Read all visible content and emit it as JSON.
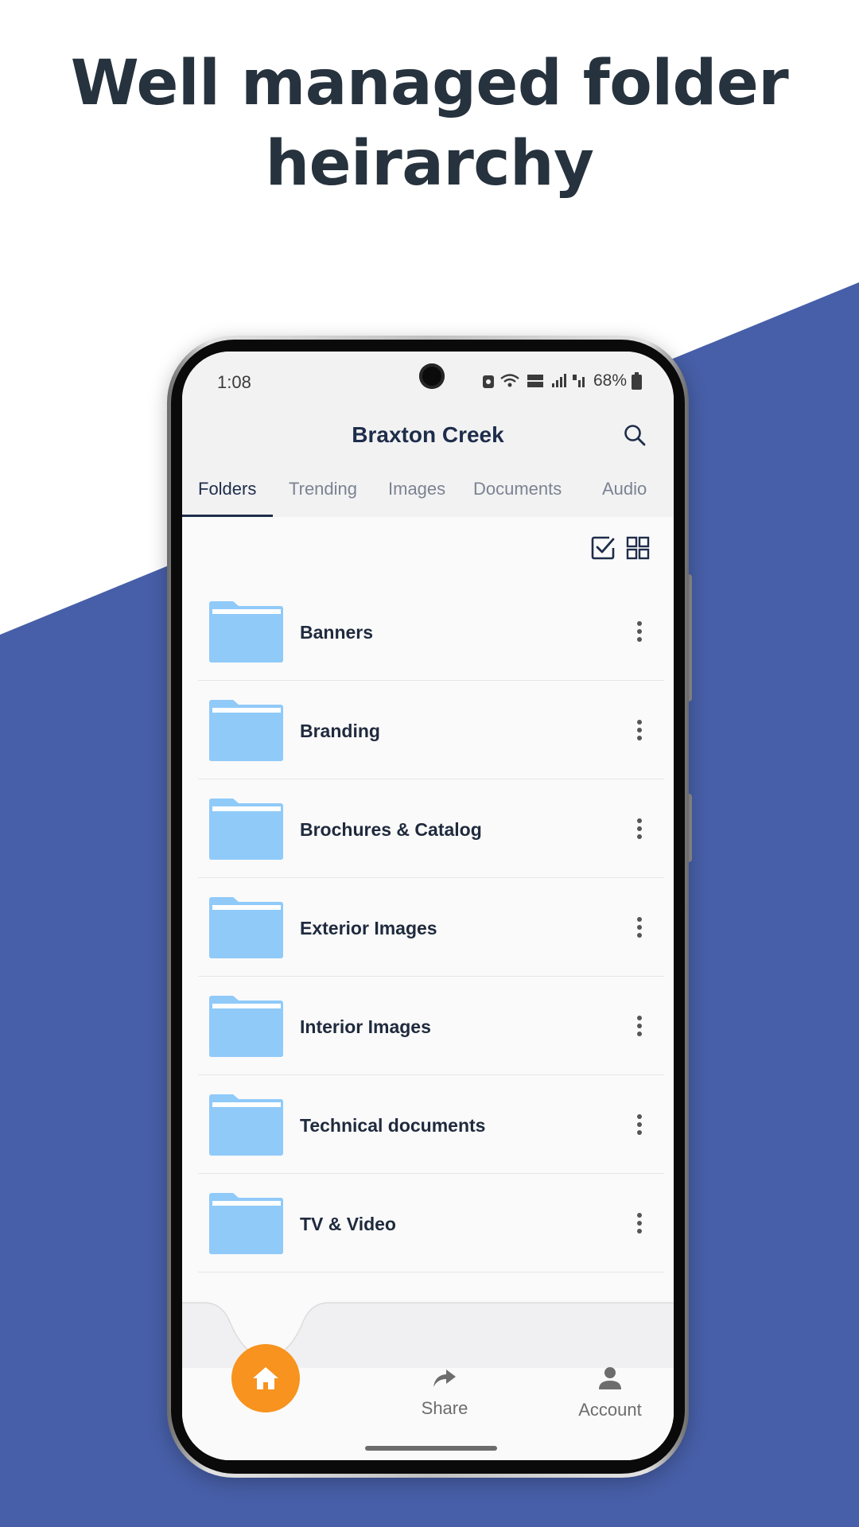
{
  "colors": {
    "background_top": "#ffffff",
    "background_diagonal": "#475fa8",
    "headline": "#26323d",
    "brand_navy": "#1e2d4a",
    "folder_blue": "#90caf9",
    "fab_orange": "#f7931e"
  },
  "headline": {
    "line1": "Well managed folder",
    "line2": "heirarchy"
  },
  "status_bar": {
    "time": "1:08",
    "battery": "68%",
    "icons": [
      "camera-icon",
      "alarm-icon",
      "wifi-icon",
      "volte-icon",
      "signal-icon",
      "roaming-signal-icon",
      "battery-icon"
    ]
  },
  "header": {
    "title": "Braxton Creek",
    "search_icon": "search-icon"
  },
  "tabs": [
    {
      "label": "Folders",
      "active": true
    },
    {
      "label": "Trending",
      "active": false
    },
    {
      "label": "Images",
      "active": false
    },
    {
      "label": "Documents",
      "active": false
    },
    {
      "label": "Audio",
      "active": false
    }
  ],
  "toolbar": {
    "select_icon": "checkbox-select-icon",
    "grid_icon": "grid-view-icon"
  },
  "folders": [
    {
      "name": "Banners"
    },
    {
      "name": "Branding"
    },
    {
      "name": "Brochures & Catalog"
    },
    {
      "name": "Exterior Images"
    },
    {
      "name": "Interior Images"
    },
    {
      "name": "Technical documents"
    },
    {
      "name": "TV & Video"
    }
  ],
  "bottom_nav": {
    "home_icon": "home-icon",
    "share": {
      "label": "Share",
      "icon": "share-icon"
    },
    "account": {
      "label": "Account",
      "icon": "account-icon"
    }
  }
}
